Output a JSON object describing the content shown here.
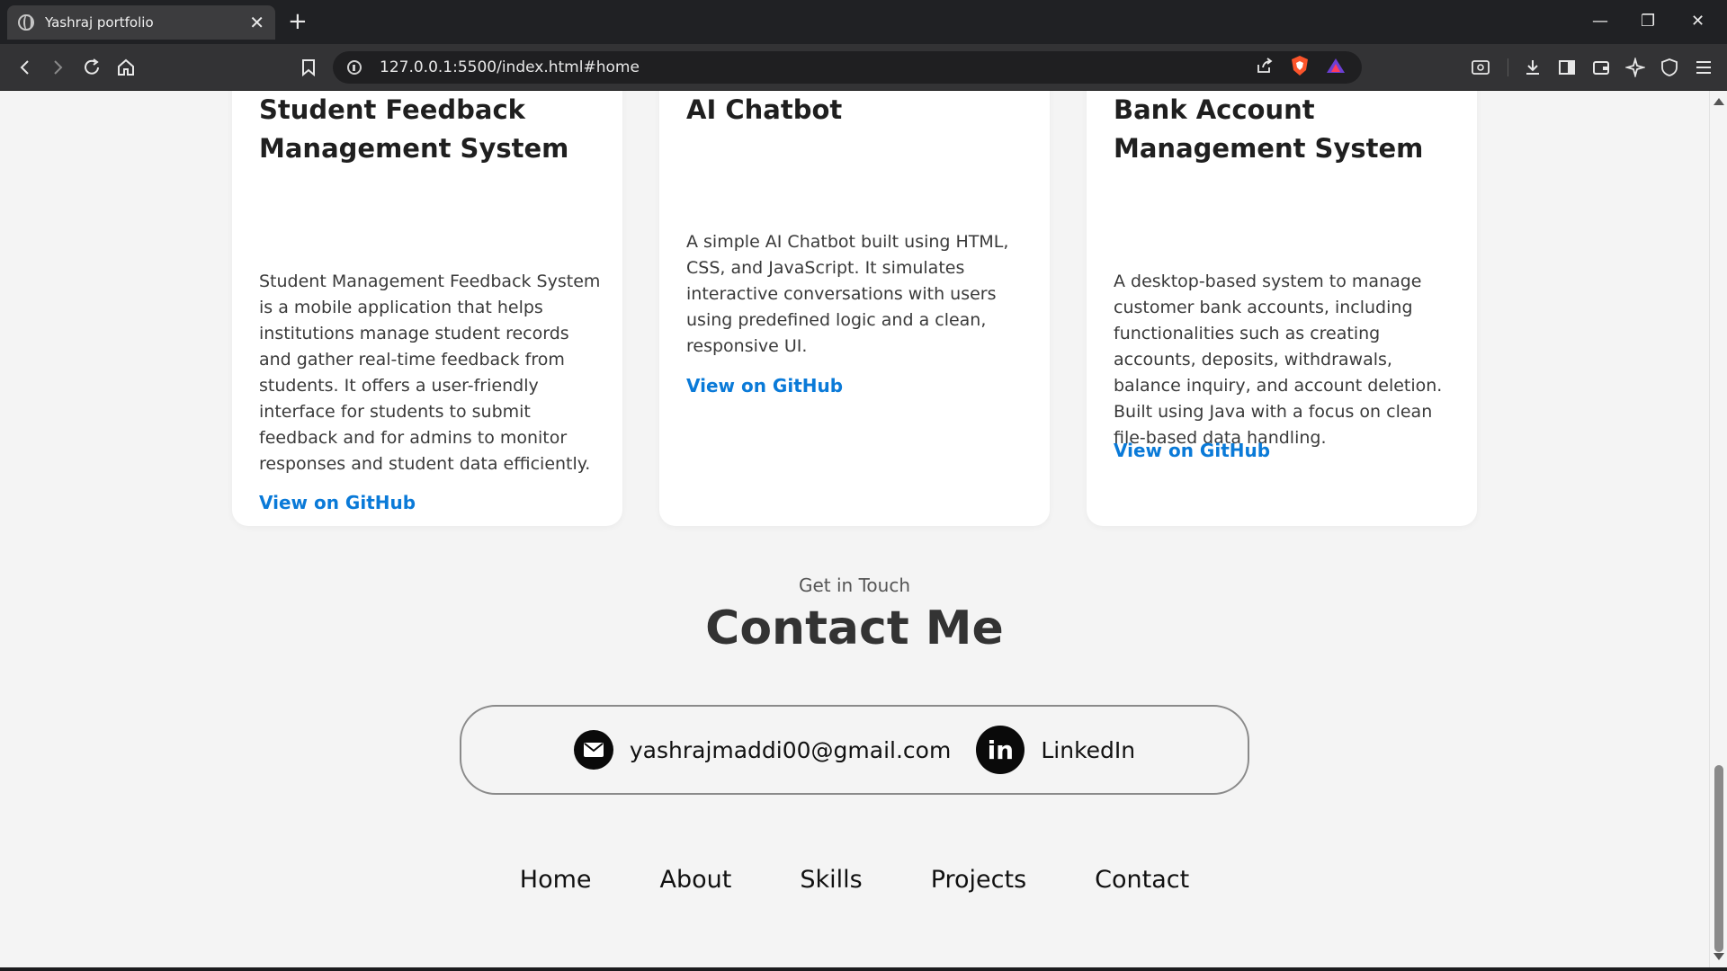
{
  "browser": {
    "tab_title": "Yashraj portfolio",
    "tab_close": "✕",
    "new_tab": "+",
    "url": "127.0.0.1:5500/index.html#home",
    "window_controls": {
      "minimize": "—",
      "restore": "❐",
      "close": "✕"
    }
  },
  "projects": [
    {
      "title": "Student Feedback Management System",
      "description": "Student Management Feedback System is a mobile application that helps institutions manage student records and gather real-time feedback from students. It offers a user-friendly interface for students to submit feedback and for admins to monitor responses and student data efficiently.",
      "link_label": "View on GitHub"
    },
    {
      "title": "AI Chatbot",
      "description": "A simple AI Chatbot built using HTML, CSS, and JavaScript. It simulates interactive conversations with users using predefined logic and a clean, responsive UI.",
      "link_label": "View on GitHub"
    },
    {
      "title": "Bank Account Management System",
      "description": "A desktop-based system to manage customer bank accounts, including functionalities such as creating accounts, deposits, withdrawals, balance inquiry, and account deletion. Built using Java with a focus on clean file-based data handling.",
      "link_label": "View on GitHub"
    }
  ],
  "contact": {
    "subtitle": "Get in Touch",
    "title": "Contact Me",
    "email": "yashrajmaddi00@gmail.com",
    "linkedin_label": "LinkedIn",
    "linkedin_glyph": "in"
  },
  "footer_nav": [
    "Home",
    "About",
    "Skills",
    "Projects",
    "Contact"
  ],
  "colors": {
    "page_bg": "#f4f4f4",
    "card_bg": "#ffffff",
    "link": "#0a7ad8",
    "chrome_dark": "#202124",
    "toolbar": "#333335"
  },
  "icons": {
    "back": "back-arrow-icon",
    "forward": "forward-arrow-icon",
    "reload": "reload-icon",
    "home": "home-icon",
    "bookmark": "bookmark-icon",
    "share": "share-icon",
    "brave": "brave-shield-icon",
    "rewards": "brave-rewards-icon",
    "mail": "mail-icon",
    "linkedin": "linkedin-icon"
  }
}
